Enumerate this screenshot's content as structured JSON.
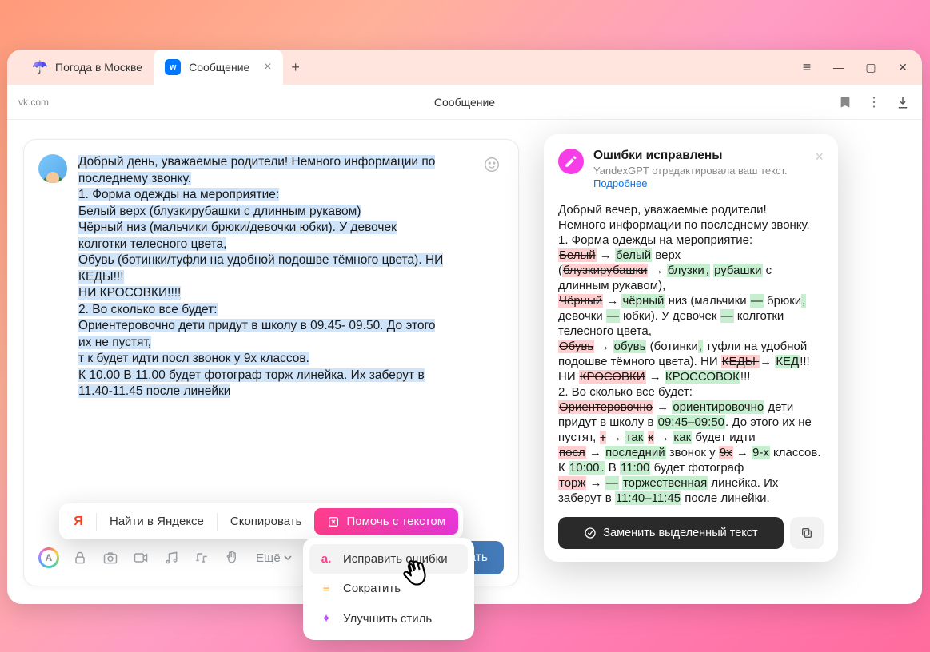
{
  "tabs": [
    {
      "label": "Погода в Москве",
      "favicon": "weather"
    },
    {
      "label": "Сообщение",
      "favicon": "vk",
      "active": true
    }
  ],
  "addressbar": {
    "url": "vk.com",
    "title": "Сообщение"
  },
  "message": {
    "lines": [
      "Добрый день, уважаемые родители! Немного информации по",
      "последнему звонку.",
      "1. Форма одежды на мероприятие:",
      "Белый верх (блузкирубашки с длинным рукавом)",
      "Чёрный низ (мальчики брюки/девочки юбки). У девочек",
      "колготки телесного цвета,",
      "Обувь (ботинки/туфли на удобной подошве тёмного цвета). НИ",
      "КЕДЫ!!!",
      "НИ КРОСОВКИ!!!!",
      "2. Во сколько все будет:",
      "Ориентеровочно дети придут в школу в 09.45- 09.50. До этого",
      "их не пустят,",
      "т к будет идти посл звонок у 9х классов.",
      "К 10.00 В 11.00 будет фотограф торж линейка. Их заберут в",
      "11.40-11.45 после линейки"
    ]
  },
  "selection_popup": {
    "search": "Найти в Яндексе",
    "copy": "Скопировать",
    "help": "Помочь с текстом"
  },
  "dropdown": {
    "items": [
      {
        "icon": "spellcheck",
        "label": "Исправить ошибки",
        "active": true
      },
      {
        "icon": "shorten",
        "label": "Сократить"
      },
      {
        "icon": "improve",
        "label": "Улучшить стиль"
      }
    ]
  },
  "toolbar": {
    "more": "Ещё",
    "publish": "Опубликовать"
  },
  "sidepanel": {
    "title": "Ошибки исправлены",
    "subtitle": "YandexGPT отредактировала ваш текст.",
    "link": "Подробнее",
    "replace": "Заменить выделенный текст",
    "diff_intro": [
      "Добрый вечер, уважаемые родители!",
      "Немного информации по последнему звонку.",
      "1. Форма одежды на мероприятие:"
    ],
    "diff_parts": {
      "belyj_del": "Белый",
      "belyj_ins": "белый",
      "verh": " верх",
      "bluzki_del": "блузкирубашки",
      "bluzki_ins": "блузки",
      "rubashki_ins": "рубашки",
      "chern_del": "Чёрный",
      "chern_ins": "чёрный",
      "niz": " низ (мальчики ",
      "dash1": "—",
      "bruki": " брюки",
      "comma_ins": ",",
      "devochki": "девочки ",
      "jubki": "юбки",
      "udevochek": "). У девочек ",
      "kolgot": "колготки телесного цвета,",
      "obuv_del": "Обувь",
      "obuv_ins": "обувь",
      "botinki": " (ботинки",
      "tufli": "туфли на удобной подошве тёмного цвета). НИ ",
      "kedy_del": "КЕДЫ ",
      "ked_ins": "КЕД",
      "ked_excl": "!!!",
      "ni": "НИ ",
      "krosovki_del": "КРОСОВКИ",
      "krossovok_ins": "КРОССОВОК",
      "kr_excl": "!!!",
      "section2": "2. Во сколько все будет:",
      "orient_del": "Ориентеровочно",
      "orient_ins": "ориентировочно",
      "deti": " дети придут в школу в ",
      "time1": "09:45–09:50",
      "doetogo": ". До этого их не пустят, ",
      "t_del": "т",
      "tak_ins": "так",
      "k_del": "к",
      "kak_ins": "как",
      "budet": " будет идти",
      "posl_del": "посл",
      "posled_ins": "последний",
      "zvonok": " звонок у ",
      "9x_del": "9х",
      "9x_ins": "9-х",
      "klassov": " классов.",
      "k10": "К ",
      "t10": "10:00",
      "dot": ".",
      "v11": " В ",
      "t11": "11:00",
      "fotog": " будет фотограф",
      "torzh_del": "торж",
      "torzh_ins": "торжественная",
      "lineika": " линейка. Их заберут в ",
      "t1140": "11:40–11:45",
      "posle": " после линейки."
    }
  }
}
